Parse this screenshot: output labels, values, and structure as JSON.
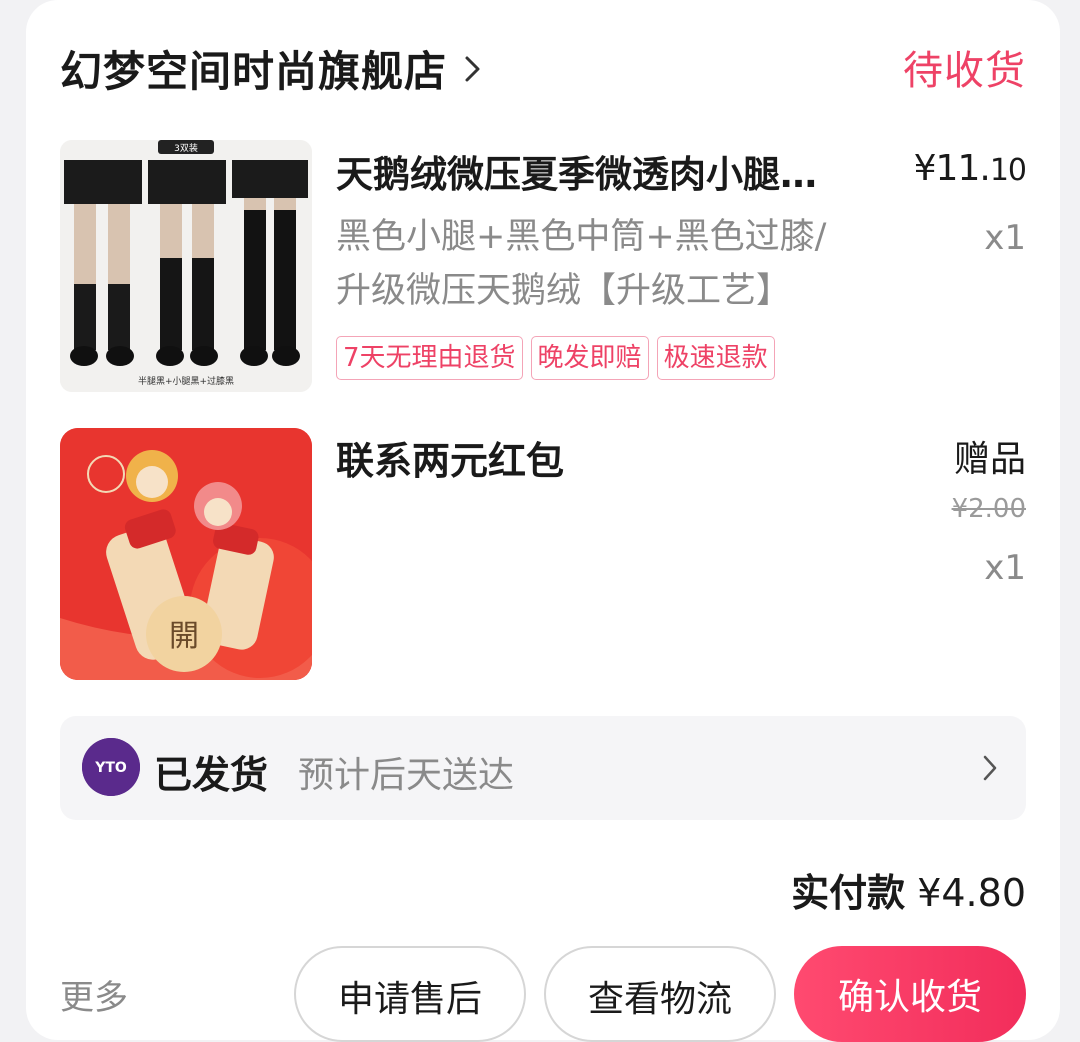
{
  "store": {
    "name": "幻梦空间时尚旗舰店",
    "status": "待收货"
  },
  "items": [
    {
      "title": "天鹅绒微压夏季微透肉小腿…",
      "variant_line1": "黑色小腿+黑色中筒+黑色过膝/",
      "variant_line2": "升级微压天鹅绒【升级工艺】",
      "price_main": "¥11.",
      "price_cents": "10",
      "qty": "x1",
      "tags": [
        "7天无理由退货",
        "晚发即赔",
        "极速退款"
      ],
      "image_badge": "3双装",
      "image_caption": "半腿黑+小腿黑+过膝黑"
    },
    {
      "title": "联系两元红包",
      "price_label": "赠品",
      "original_price": "¥2.00",
      "qty": "x1",
      "image_button": "開"
    }
  ],
  "shipping": {
    "status": "已发货",
    "eta": "预计后天送达",
    "courier_logo": "YTO"
  },
  "total": {
    "label": "实付款",
    "amount": "¥4.80"
  },
  "actions": {
    "more": "更多",
    "after_sales": "申请售后",
    "track": "查看物流",
    "confirm": "确认收货"
  },
  "colors": {
    "accent": "#ee4266",
    "tag_border": "#f4a4b7",
    "courier": "#5a2a8c"
  }
}
